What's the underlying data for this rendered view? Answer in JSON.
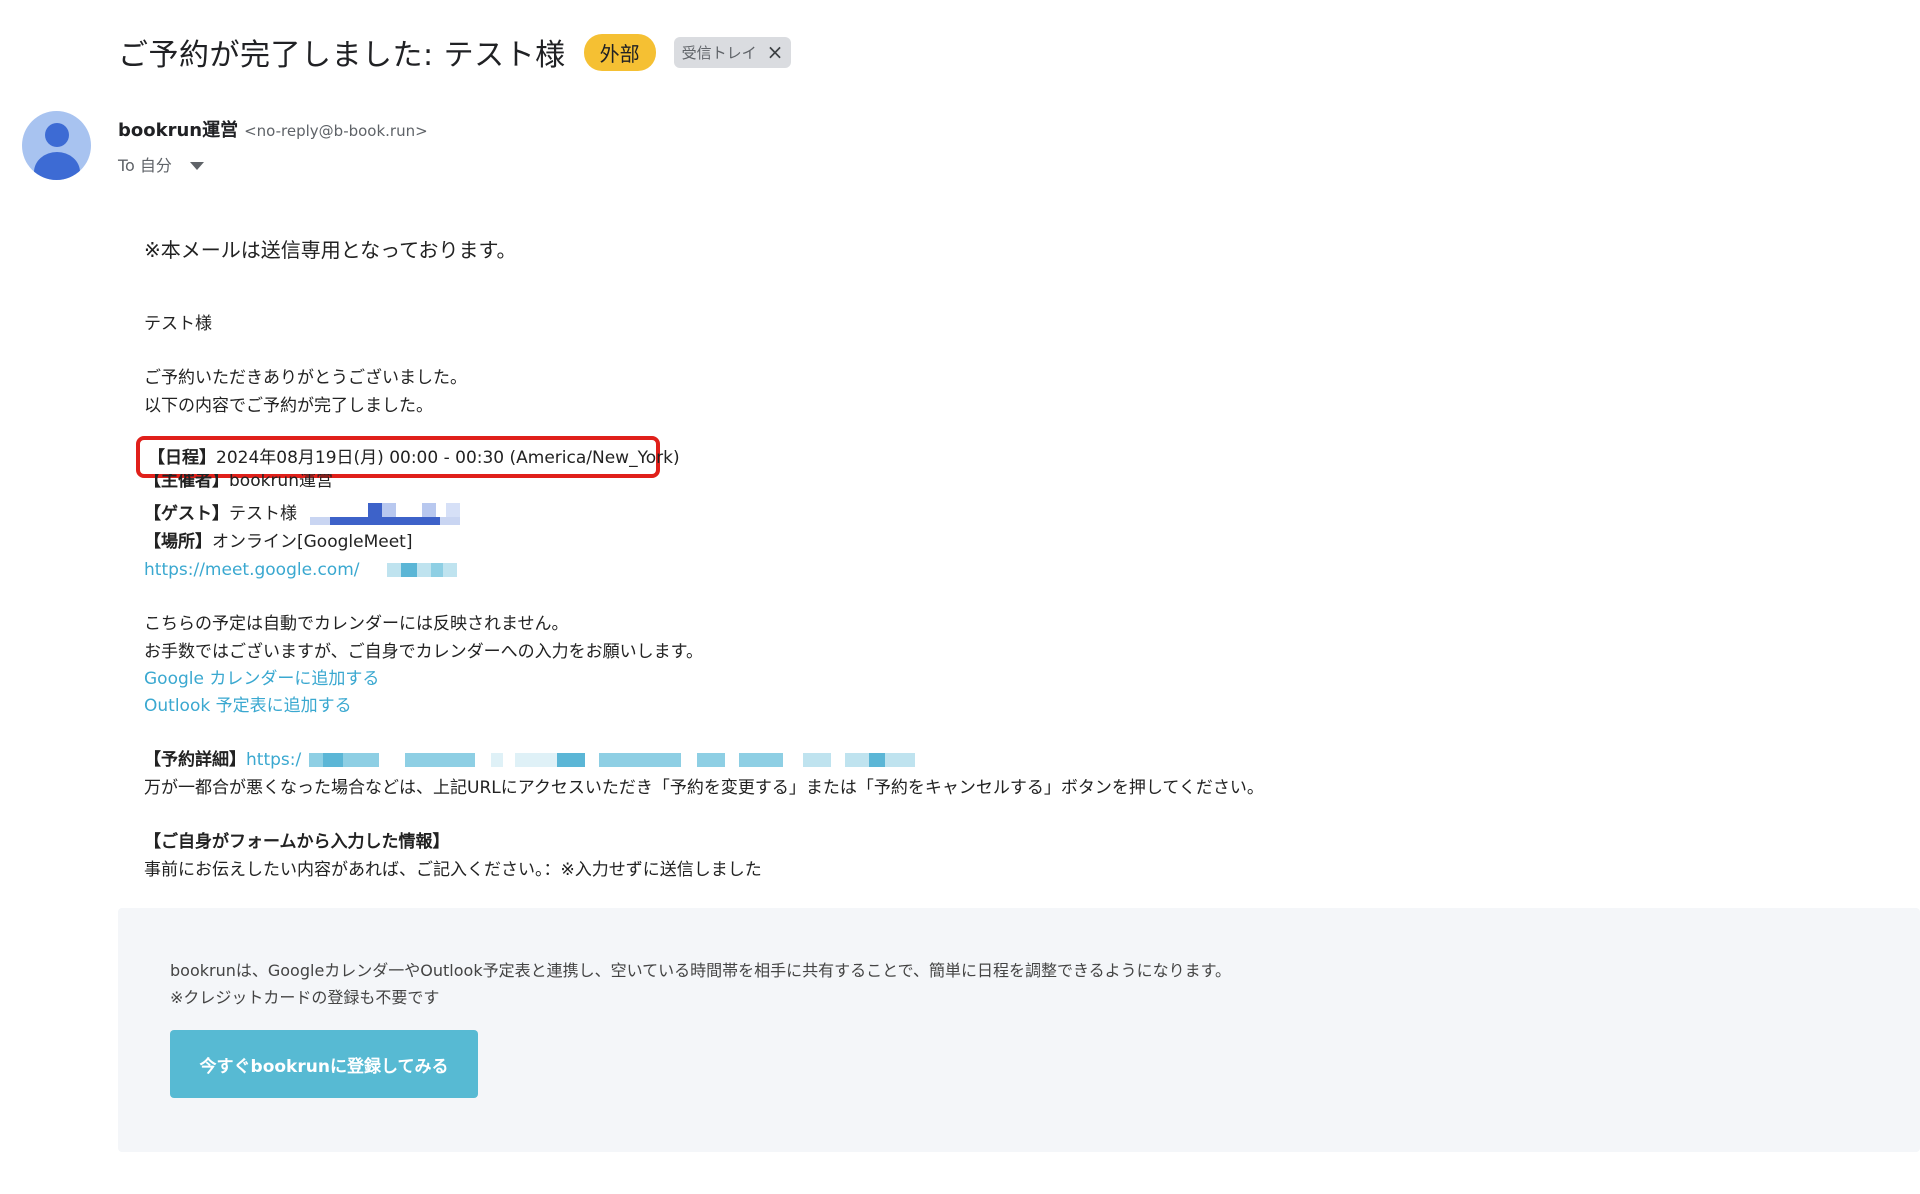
{
  "header": {
    "subject": "ご予約が完了しました: テスト様",
    "badge_external": "外部",
    "badge_inbox": "受信トレイ",
    "badge_inbox_close": "×"
  },
  "sender": {
    "name": "bookrun運営",
    "email": "<no-reply@b-book.run>",
    "to_label": "To 自分"
  },
  "body": {
    "notice": "※本メールは送信専用となっております。",
    "greeting": "テスト様",
    "thanks_1": "ご予約いただきありがとうございました。",
    "thanks_2": "以下の内容でご予約が完了しました。",
    "schedule_label": "【日程】",
    "schedule_value": "2024年08月19日(月) 00:00 - 00:30 (America/New_York)",
    "organizer_label": "【主催者】",
    "organizer_value": "bookrun運営",
    "guest_label": "【ゲスト】",
    "guest_value": "テスト様",
    "place_label": "【場所】",
    "place_value": "オンライン[GoogleMeet]",
    "meet_link": "https://meet.google.com/",
    "calendar_note_1": "こちらの予定は自動でカレンダーには反映されません。",
    "calendar_note_2": "お手数ではございますが、ご自身でカレンダーへの入力をお願いします。",
    "google_link": "Google カレンダーに追加する",
    "outlook_link": "Outlook 予定表に追加する",
    "details_label": "【予約詳細】",
    "details_link": "https:/",
    "change_note": "万が一都合が悪くなった場合などは、上記URLにアクセスいただき「予約を変更する」または「予約をキャンセルする」ボタンを押してください。",
    "form_heading": "【ご自身がフォームから入力した情報】",
    "form_value": "事前にお伝えしたい内容があれば、ご記入ください。：※入力せずに送信しました"
  },
  "footer": {
    "text_1": "bookrunは、Googleカレンダ一やOutlook予定表と連携し、空いている時間帯を相手に共有することで、簡単に日程を調整できるようになります。",
    "text_2": "※クレジットカードの登録も不要です",
    "cta_label": "今すぐbookrunに登録してみる"
  },
  "colors": {
    "badge_external": "#f5c033",
    "link": "#3aa8d0",
    "highlight": "#e0201a",
    "cta": "#57bad3",
    "avatar": "#a8c3f0"
  }
}
